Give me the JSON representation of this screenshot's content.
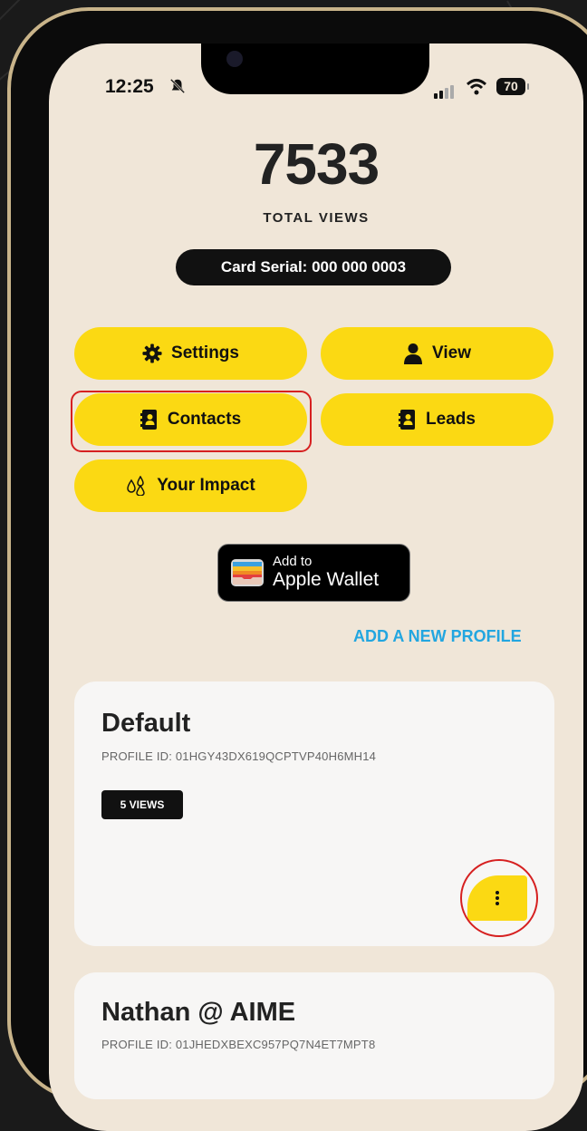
{
  "status": {
    "time": "12:25",
    "battery": "70"
  },
  "stats": {
    "total_views": "7533",
    "total_label": "TOTAL VIEWS",
    "serial": "Card Serial: 000 000 0003"
  },
  "buttons": {
    "settings": "Settings",
    "view": "View",
    "contacts": "Contacts",
    "leads": "Leads",
    "impact": "Your Impact"
  },
  "wallet": {
    "line1": "Add to",
    "line2": "Apple Wallet"
  },
  "add_profile": "ADD A NEW PROFILE",
  "profiles": [
    {
      "name": "Default",
      "id": "PROFILE ID: 01HGY43DX619QCPTVP40H6MH14",
      "views": "5 VIEWS"
    },
    {
      "name": "Nathan @ AIME",
      "id": "PROFILE ID: 01JHEDXBEXC957PQ7N4ET7MPT8"
    }
  ],
  "colors": {
    "accent": "#fbd913",
    "background": "#f0e6d8",
    "link": "#22a6e0",
    "highlight": "#d62020"
  }
}
